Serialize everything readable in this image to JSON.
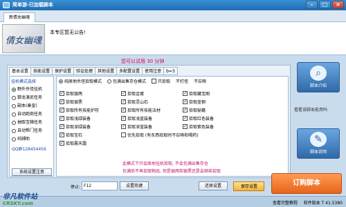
{
  "window": {
    "title": "简单游-已加载脚本",
    "min": "–",
    "max": "□",
    "close": "×"
  },
  "tabs": {
    "tab1": "新倩女幽魂"
  },
  "notice": {
    "logo_text": "倩女幽魂",
    "text": "本专区暂无公告!"
  },
  "trial": "您可以试用 30 分钟",
  "panel_tabs": [
    "基本设置",
    "技能设置",
    "保护设置",
    "验证处理",
    "其他设置",
    "多配置设置",
    "使用注意",
    "b=3"
  ],
  "side": {
    "header": "挂机模式选择",
    "items": [
      "野外杀怪挂机",
      "御龙演武任务",
      "副本(秦皇)",
      "自动跑商任务",
      "抽取宝箱任务",
      "自动帮门任务",
      "纯辅助"
    ],
    "qq": "QQ群128454456",
    "sys_button": "系统设置注意"
  },
  "modes": [
    "纯原地杀怪拾取模式",
    "包满出售存仓模式",
    "只拾取",
    "不打怪",
    "不召唤"
  ],
  "options": [
    [
      "拾取银两",
      "拾取金蛋",
      "拾取藏宝图"
    ],
    [
      "拾取银票",
      "拾取灵山石",
      "拾取壶钢"
    ],
    [
      "拾取所有技能护符",
      "拾取所有技能法材",
      "拾取秘籍"
    ],
    [
      "拾取浅绿装备",
      "拾取浅蓝装备",
      "拾取红色装备"
    ],
    [
      "拾取深绿装备",
      "拾取深蓝装备",
      "拾取紫色装备"
    ],
    [
      "拾取宝石",
      "优先拾取 (有东西拾取时不召唤和喝药)",
      ""
    ],
    [
      "拾取晨天霜",
      "",
      ""
    ]
  ],
  "warnings": [
    "此模式下只会原地挂机拾取, 不会包满出售存仓",
    "包满后不再拾取物品, 但是银两和银票还是会继续拾取"
  ],
  "bottom": {
    "stop_label": "停止:",
    "hotkey": "F12",
    "hotkey_btn": "设置热键",
    "restore_btn": "还原设置",
    "save_btn": "保存设置"
  },
  "right": {
    "script_intro": "脚本介绍",
    "view_link": "看看该脚本能用吗",
    "script_manual": "脚本说明",
    "order": "订购脚本"
  },
  "status": {
    "site": "查看完整教程",
    "version": "软件版本 T 41.5380"
  },
  "brand": {
    "name": "非凡软件站",
    "site": "CRSKY.com"
  },
  "colors": {
    "title_bg": "#1f6db4",
    "warn": "#c01070",
    "order": "#e8641c"
  }
}
